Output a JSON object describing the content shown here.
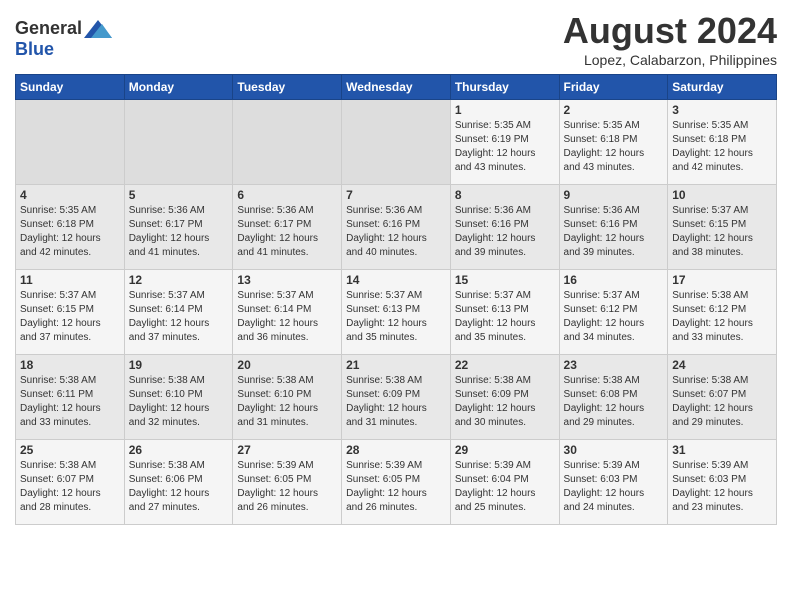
{
  "header": {
    "logo_general": "General",
    "logo_blue": "Blue",
    "month_year": "August 2024",
    "location": "Lopez, Calabarzon, Philippines"
  },
  "days_of_week": [
    "Sunday",
    "Monday",
    "Tuesday",
    "Wednesday",
    "Thursday",
    "Friday",
    "Saturday"
  ],
  "weeks": [
    {
      "cells": [
        {
          "empty": true
        },
        {
          "empty": true
        },
        {
          "empty": true
        },
        {
          "empty": true
        },
        {
          "day": "1",
          "sunrise": "5:35 AM",
          "sunset": "6:19 PM",
          "daylight": "12 hours and 43 minutes."
        },
        {
          "day": "2",
          "sunrise": "5:35 AM",
          "sunset": "6:18 PM",
          "daylight": "12 hours and 43 minutes."
        },
        {
          "day": "3",
          "sunrise": "5:35 AM",
          "sunset": "6:18 PM",
          "daylight": "12 hours and 42 minutes."
        }
      ]
    },
    {
      "cells": [
        {
          "day": "4",
          "sunrise": "5:35 AM",
          "sunset": "6:18 PM",
          "daylight": "12 hours and 42 minutes."
        },
        {
          "day": "5",
          "sunrise": "5:36 AM",
          "sunset": "6:17 PM",
          "daylight": "12 hours and 41 minutes."
        },
        {
          "day": "6",
          "sunrise": "5:36 AM",
          "sunset": "6:17 PM",
          "daylight": "12 hours and 41 minutes."
        },
        {
          "day": "7",
          "sunrise": "5:36 AM",
          "sunset": "6:16 PM",
          "daylight": "12 hours and 40 minutes."
        },
        {
          "day": "8",
          "sunrise": "5:36 AM",
          "sunset": "6:16 PM",
          "daylight": "12 hours and 39 minutes."
        },
        {
          "day": "9",
          "sunrise": "5:36 AM",
          "sunset": "6:16 PM",
          "daylight": "12 hours and 39 minutes."
        },
        {
          "day": "10",
          "sunrise": "5:37 AM",
          "sunset": "6:15 PM",
          "daylight": "12 hours and 38 minutes."
        }
      ]
    },
    {
      "cells": [
        {
          "day": "11",
          "sunrise": "5:37 AM",
          "sunset": "6:15 PM",
          "daylight": "12 hours and 37 minutes."
        },
        {
          "day": "12",
          "sunrise": "5:37 AM",
          "sunset": "6:14 PM",
          "daylight": "12 hours and 37 minutes."
        },
        {
          "day": "13",
          "sunrise": "5:37 AM",
          "sunset": "6:14 PM",
          "daylight": "12 hours and 36 minutes."
        },
        {
          "day": "14",
          "sunrise": "5:37 AM",
          "sunset": "6:13 PM",
          "daylight": "12 hours and 35 minutes."
        },
        {
          "day": "15",
          "sunrise": "5:37 AM",
          "sunset": "6:13 PM",
          "daylight": "12 hours and 35 minutes."
        },
        {
          "day": "16",
          "sunrise": "5:37 AM",
          "sunset": "6:12 PM",
          "daylight": "12 hours and 34 minutes."
        },
        {
          "day": "17",
          "sunrise": "5:38 AM",
          "sunset": "6:12 PM",
          "daylight": "12 hours and 33 minutes."
        }
      ]
    },
    {
      "cells": [
        {
          "day": "18",
          "sunrise": "5:38 AM",
          "sunset": "6:11 PM",
          "daylight": "12 hours and 33 minutes."
        },
        {
          "day": "19",
          "sunrise": "5:38 AM",
          "sunset": "6:10 PM",
          "daylight": "12 hours and 32 minutes."
        },
        {
          "day": "20",
          "sunrise": "5:38 AM",
          "sunset": "6:10 PM",
          "daylight": "12 hours and 31 minutes."
        },
        {
          "day": "21",
          "sunrise": "5:38 AM",
          "sunset": "6:09 PM",
          "daylight": "12 hours and 31 minutes."
        },
        {
          "day": "22",
          "sunrise": "5:38 AM",
          "sunset": "6:09 PM",
          "daylight": "12 hours and 30 minutes."
        },
        {
          "day": "23",
          "sunrise": "5:38 AM",
          "sunset": "6:08 PM",
          "daylight": "12 hours and 29 minutes."
        },
        {
          "day": "24",
          "sunrise": "5:38 AM",
          "sunset": "6:07 PM",
          "daylight": "12 hours and 29 minutes."
        }
      ]
    },
    {
      "cells": [
        {
          "day": "25",
          "sunrise": "5:38 AM",
          "sunset": "6:07 PM",
          "daylight": "12 hours and 28 minutes."
        },
        {
          "day": "26",
          "sunrise": "5:38 AM",
          "sunset": "6:06 PM",
          "daylight": "12 hours and 27 minutes."
        },
        {
          "day": "27",
          "sunrise": "5:39 AM",
          "sunset": "6:05 PM",
          "daylight": "12 hours and 26 minutes."
        },
        {
          "day": "28",
          "sunrise": "5:39 AM",
          "sunset": "6:05 PM",
          "daylight": "12 hours and 26 minutes."
        },
        {
          "day": "29",
          "sunrise": "5:39 AM",
          "sunset": "6:04 PM",
          "daylight": "12 hours and 25 minutes."
        },
        {
          "day": "30",
          "sunrise": "5:39 AM",
          "sunset": "6:03 PM",
          "daylight": "12 hours and 24 minutes."
        },
        {
          "day": "31",
          "sunrise": "5:39 AM",
          "sunset": "6:03 PM",
          "daylight": "12 hours and 23 minutes."
        }
      ]
    }
  ],
  "labels": {
    "sunrise_prefix": "Sunrise:",
    "sunset_prefix": "Sunset:",
    "daylight_prefix": "Daylight:"
  }
}
